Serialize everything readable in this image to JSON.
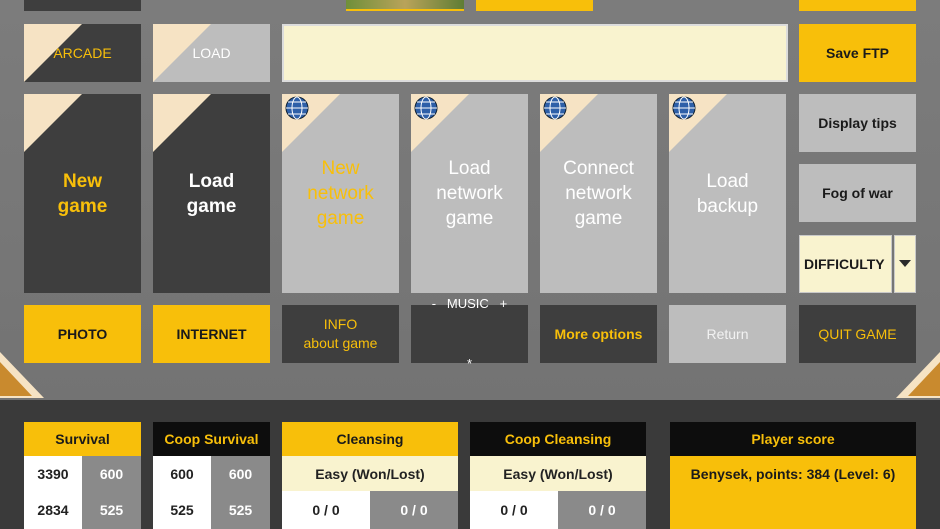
{
  "menu": {
    "arcade": "ARCADE",
    "load_small": "LOAD",
    "save_ftp": "Save FTP",
    "new_game": [
      "New",
      "game"
    ],
    "load_game": [
      "Load",
      "game"
    ],
    "new_network_game": [
      "New",
      "network",
      "game"
    ],
    "load_network_game": [
      "Load",
      "network",
      "game"
    ],
    "connect_network_game": [
      "Connect",
      "network",
      "game"
    ],
    "load_backup": [
      "Load",
      "backup"
    ],
    "display_tips": "Display tips",
    "fog_of_war": "Fog of war",
    "difficulty": "DIFFICULTY",
    "photo": "PHOTO",
    "internet": "INTERNET",
    "info": [
      "INFO",
      "about game"
    ],
    "music": [
      "-   MUSIC   +",
      "*"
    ],
    "more_options": "More options",
    "return": "Return",
    "quit_game": "QUIT GAME",
    "text_field_value": ""
  },
  "scores": {
    "survival": {
      "title": "Survival",
      "rows": [
        [
          "3390",
          "600"
        ],
        [
          "2834",
          "525"
        ]
      ]
    },
    "coop_survival": {
      "title": "Coop Survival",
      "rows": [
        [
          "600",
          "600"
        ],
        [
          "525",
          "525"
        ]
      ]
    },
    "cleansing": {
      "title": "Cleansing",
      "subtitle": "Easy (Won/Lost)",
      "values": [
        "0 / 0",
        "0 / 0"
      ]
    },
    "coop_cleansing": {
      "title": "Coop Cleansing",
      "subtitle": "Easy (Won/Lost)",
      "values": [
        "0 / 0",
        "0 / 0"
      ]
    },
    "player_score": {
      "title": "Player score",
      "text": "Benysek,  points: 384 (Level: 6)"
    }
  },
  "colors": {
    "accent_yellow": "#f8bf0a",
    "dark_tile": "#3e3e3e",
    "light_tile": "#bdbdbd",
    "cream": "#f9f3cf"
  },
  "icons": {
    "globe": "globe-icon",
    "dropdown": "caret-down-icon"
  }
}
